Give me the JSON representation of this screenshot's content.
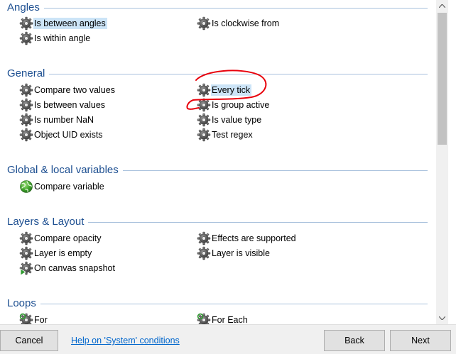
{
  "sections": [
    {
      "title": "Angles",
      "items": [
        {
          "label": "Is between angles",
          "icon": "gear-icon",
          "selected": true
        },
        {
          "label": "Is clockwise from",
          "icon": "gear-icon"
        },
        {
          "label": "Is within angle",
          "icon": "gear-icon"
        }
      ]
    },
    {
      "title": "General",
      "items": [
        {
          "label": "Compare two values",
          "icon": "gear-icon"
        },
        {
          "label": "Every tick",
          "icon": "gear-icon",
          "selected": true
        },
        {
          "label": "Is between values",
          "icon": "gear-icon"
        },
        {
          "label": "Is group active",
          "icon": "gear-icon"
        },
        {
          "label": "Is number NaN",
          "icon": "gear-icon"
        },
        {
          "label": "Is value type",
          "icon": "gear-icon"
        },
        {
          "label": "Object UID exists",
          "icon": "gear-icon"
        },
        {
          "label": "Test regex",
          "icon": "gear-icon"
        }
      ]
    },
    {
      "title": "Global & local variables",
      "items": [
        {
          "label": "Compare variable",
          "icon": "globe-icon"
        }
      ]
    },
    {
      "title": "Layers & Layout",
      "items": [
        {
          "label": "Compare opacity",
          "icon": "gear-icon"
        },
        {
          "label": "Effects are supported",
          "icon": "gear-icon"
        },
        {
          "label": "Layer is empty",
          "icon": "gear-icon"
        },
        {
          "label": "Layer is visible",
          "icon": "gear-icon"
        },
        {
          "label": "On canvas snapshot",
          "icon": "gear-trigger-icon"
        }
      ]
    },
    {
      "title": "Loops",
      "items": [
        {
          "label": "For",
          "icon": "gear-loop-icon"
        },
        {
          "label": "For Each",
          "icon": "gear-loop-icon"
        }
      ]
    }
  ],
  "footer": {
    "cancel_label": "Cancel",
    "help_link": "Help on 'System' conditions",
    "back_label": "Back",
    "next_label": "Next"
  },
  "colors": {
    "section_title": "#1d4f91",
    "section_rule": "#a9c1dd",
    "selection": "#cce4f7",
    "link": "#0066cc",
    "annotation": "#e8000b"
  }
}
